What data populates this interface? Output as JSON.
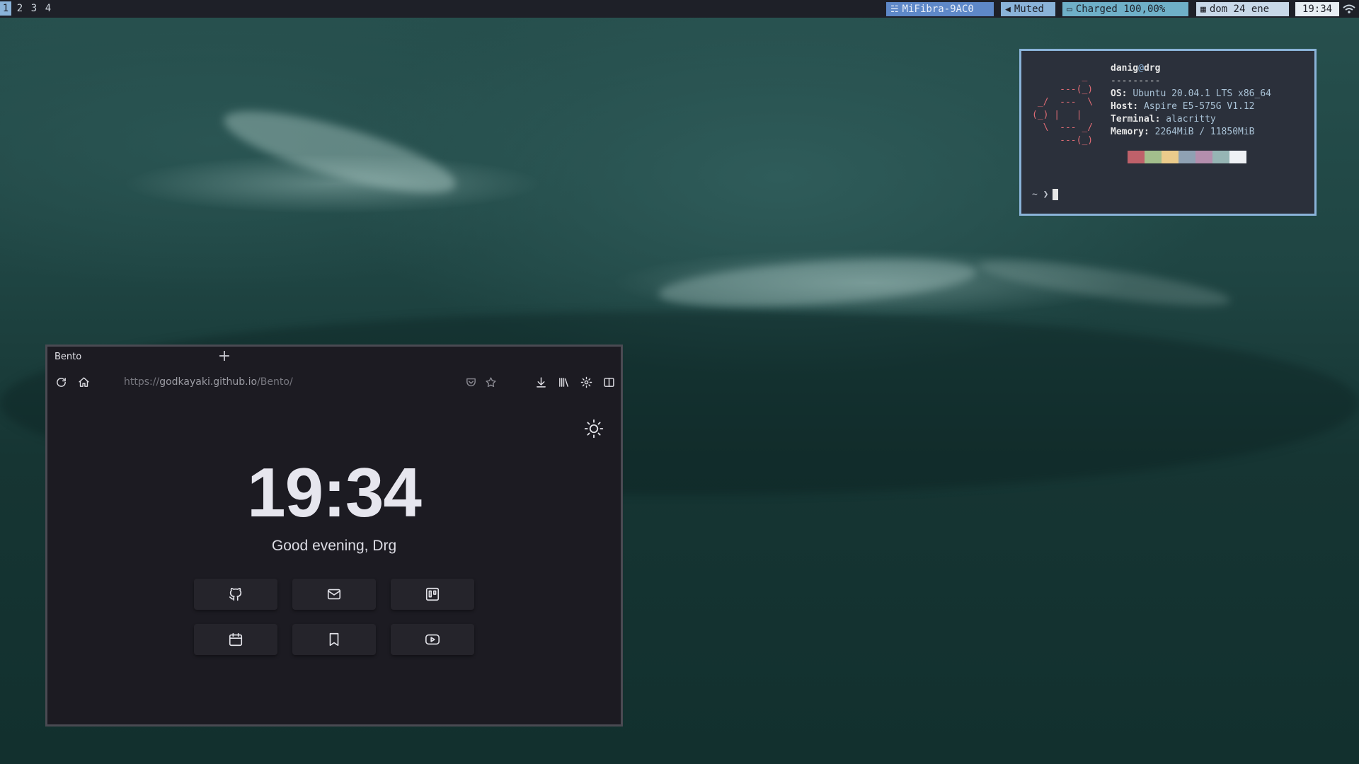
{
  "topbar": {
    "workspaces": [
      "1",
      "2",
      "3",
      "4"
    ],
    "active_workspace": "1",
    "network": {
      "icon": "wifi-icon",
      "label": "MiFibra-9AC0",
      "color": "#5e88c8"
    },
    "volume": {
      "icon": "speaker-icon",
      "label": "Muted",
      "color": "#8ab3d9"
    },
    "battery": {
      "icon": "battery-icon",
      "label": "Charged 100,00%",
      "color": "#6fb0c8"
    },
    "date": {
      "icon": "calendar-icon",
      "label": "dom 24 ene",
      "color": "#c8d8e8"
    },
    "time": {
      "label": "19:34",
      "color": "#e8eef4"
    },
    "tray_icon": "wifi-icon"
  },
  "terminal": {
    "user": "danig",
    "at": "@",
    "host": "drg",
    "separator": "---------",
    "os_key": "OS:",
    "os_val": "Ubuntu 20.04.1 LTS x86_64",
    "host_key": "Host:",
    "host_val": "Aspire E5-575G V1.12",
    "terminal_key": "Terminal:",
    "terminal_val": "alacritty",
    "memory_key": "Memory:",
    "memory_val": "2264MiB / 11850MiB",
    "palette": [
      "#2b303b",
      "#bf616a",
      "#a3be8c",
      "#ebcb8b",
      "#8fa1b3",
      "#b48ead",
      "#96b5b4",
      "#eff1f5"
    ],
    "prompt": "~ ❯",
    "logo": "ubuntu-logo"
  },
  "browser": {
    "tab_title": "Bento",
    "new_tab": "+",
    "url_scheme": "https://",
    "url_host": "godkayaki.github.io",
    "url_path": "/Bento/",
    "clock": "19:34",
    "greeting": "Good evening, Drg",
    "links": [
      {
        "icon": "github-icon"
      },
      {
        "icon": "mail-icon"
      },
      {
        "icon": "trello-icon"
      },
      {
        "icon": "calendar-icon"
      },
      {
        "icon": "bookmark-icon"
      },
      {
        "icon": "youtube-icon"
      }
    ]
  }
}
